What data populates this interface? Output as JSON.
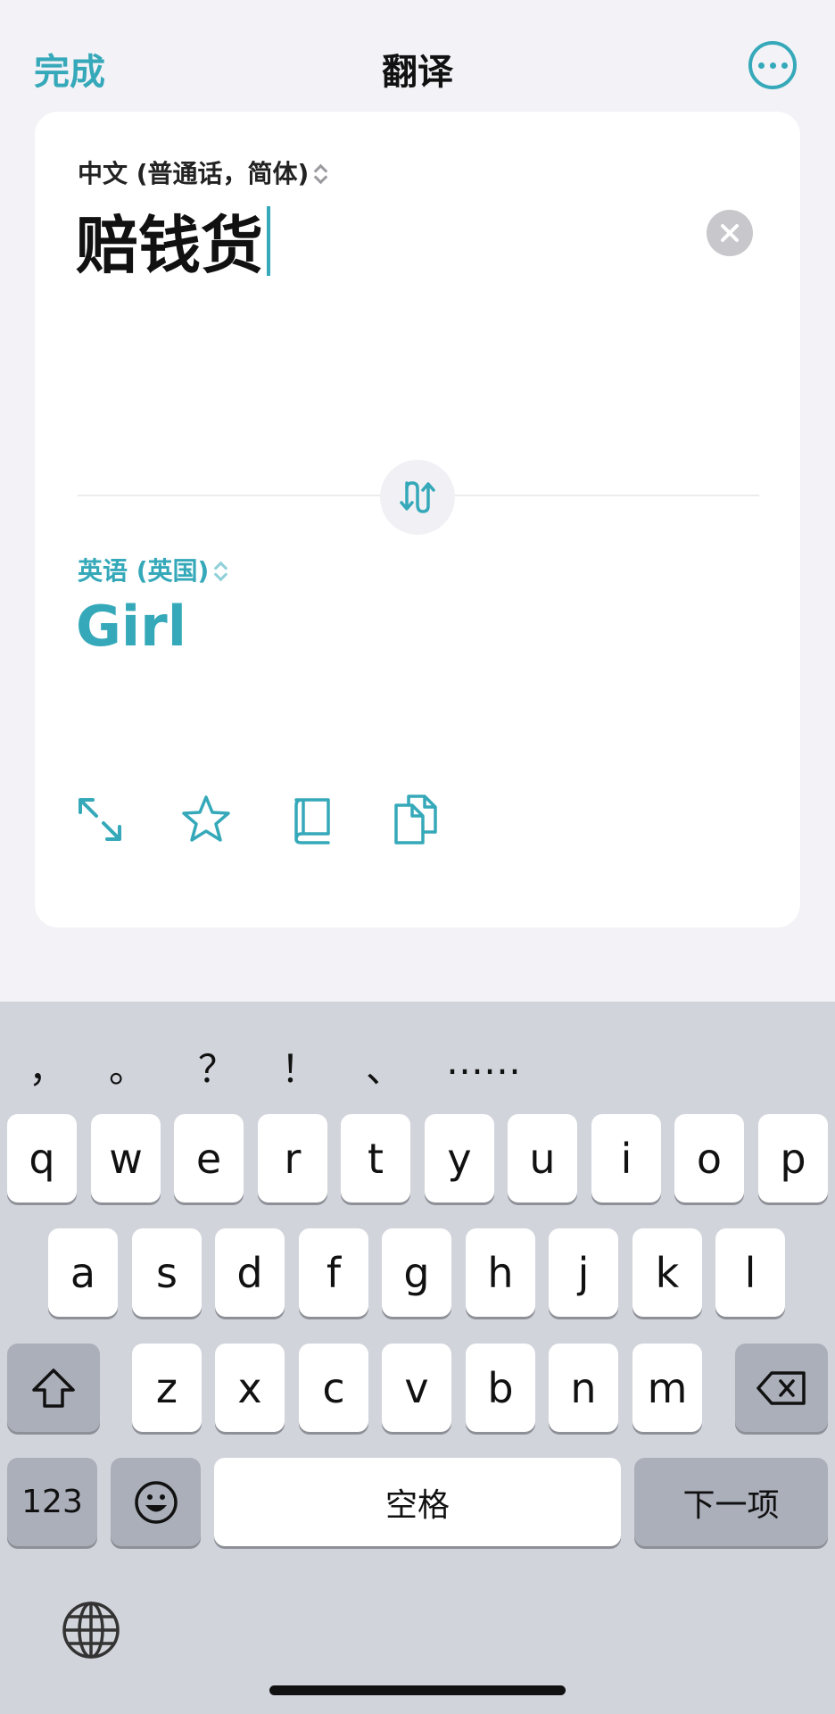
{
  "header": {
    "done_label": "完成",
    "title": "翻译",
    "more_icon": "ellipsis-circle-icon"
  },
  "translator": {
    "source_language": "中文 (普通话，简体)",
    "source_text": "赔钱货",
    "target_language": "英语 (英国)",
    "target_text": "Girl",
    "tools": [
      "expand-icon",
      "star-icon",
      "dictionary-book-icon",
      "copy-icon"
    ]
  },
  "keyboard": {
    "punctuation": [
      "，",
      "。",
      "？",
      "！",
      "、",
      "……"
    ],
    "row1": [
      "q",
      "w",
      "e",
      "r",
      "t",
      "y",
      "u",
      "i",
      "o",
      "p"
    ],
    "row2": [
      "a",
      "s",
      "d",
      "f",
      "g",
      "h",
      "j",
      "k",
      "l"
    ],
    "row3": [
      "z",
      "x",
      "c",
      "v",
      "b",
      "n",
      "m"
    ],
    "numbers_label": "123",
    "space_label": "空格",
    "next_label": "下一项"
  },
  "colors": {
    "accent": "#35a9b9",
    "keyboard_bg": "#d1d4db",
    "key_dark": "#abafba"
  }
}
